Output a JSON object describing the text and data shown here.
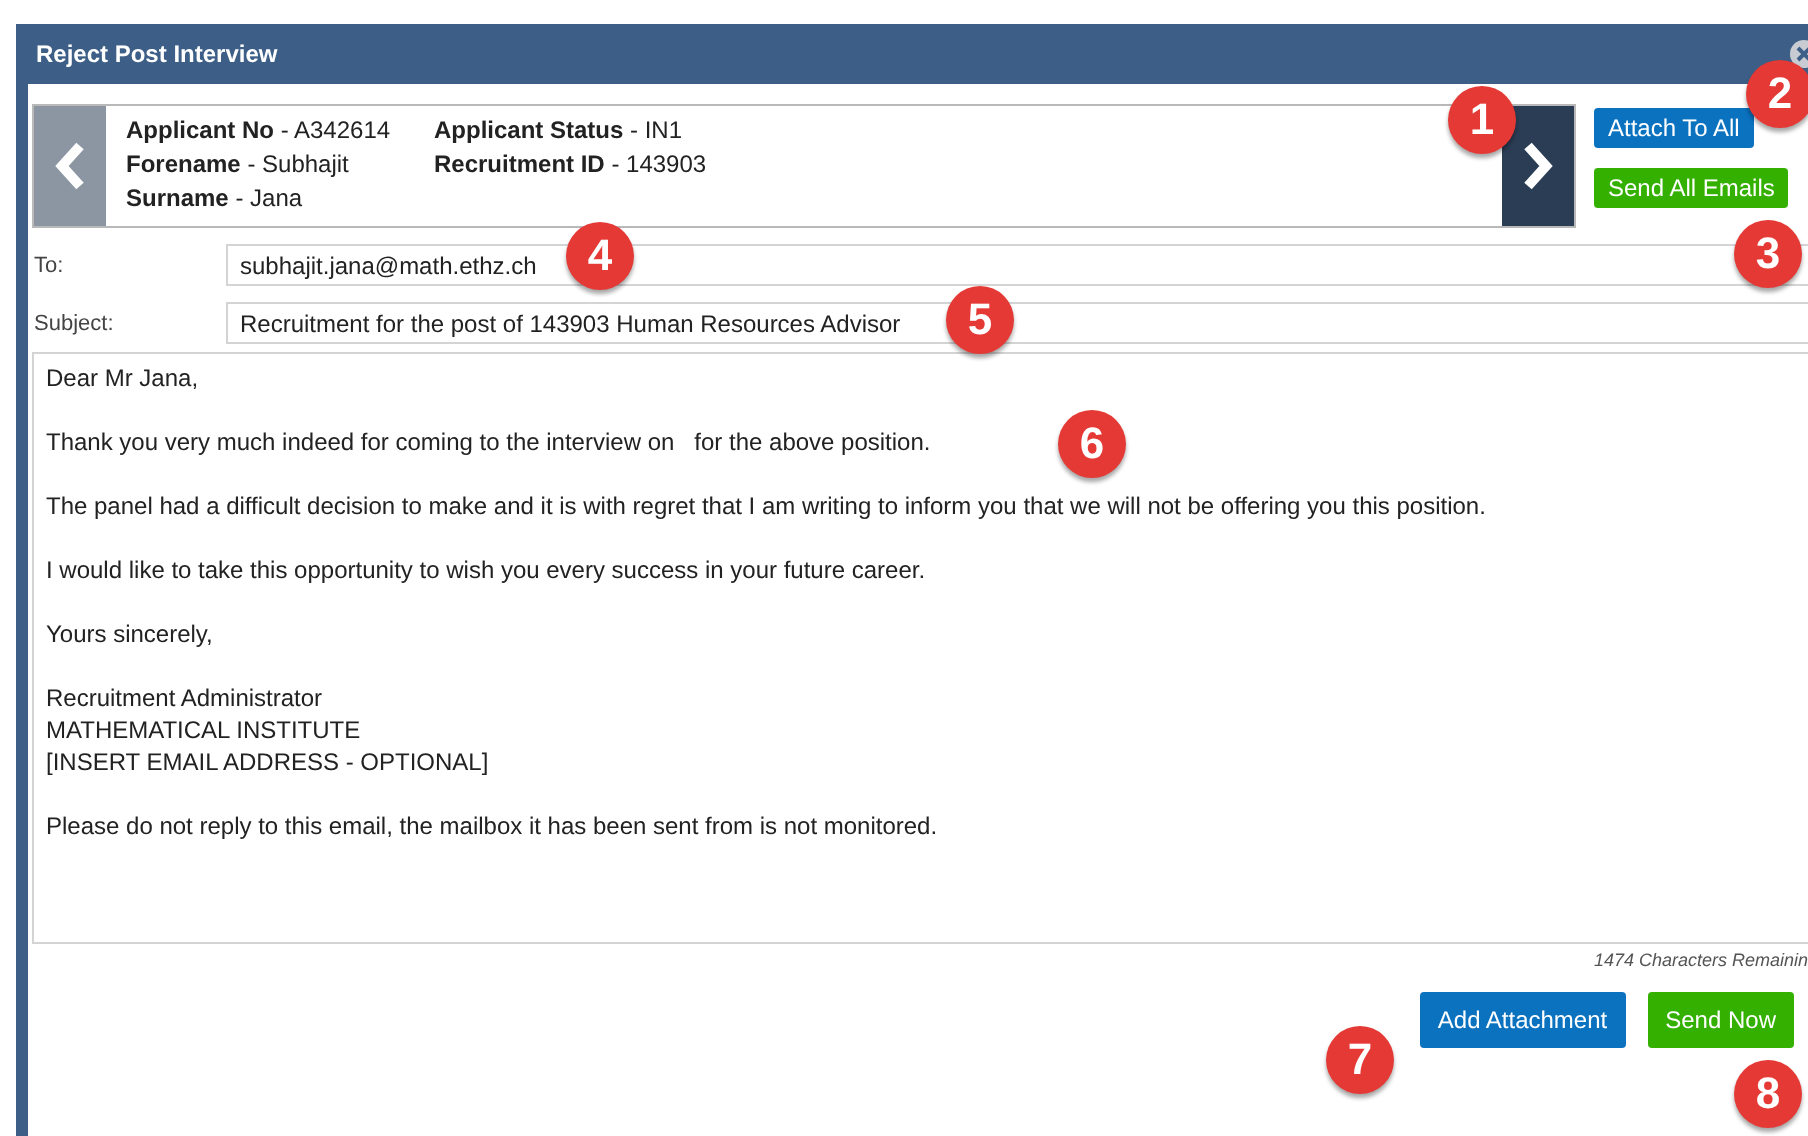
{
  "window": {
    "title": "Reject Post Interview"
  },
  "applicant": {
    "columns": [
      [
        {
          "label": "Applicant No",
          "value": "- A342614"
        },
        {
          "label": "Forename",
          "value": "- Subhajit"
        },
        {
          "label": "Surname",
          "value": "- Jana"
        }
      ],
      [
        {
          "label": "Applicant Status",
          "value": "- IN1"
        },
        {
          "label": "Recruitment ID",
          "value": "- 143903"
        }
      ]
    ]
  },
  "header_buttons": [
    {
      "label": "Attach To All",
      "kind": "primary"
    },
    {
      "label": "Send All Emails",
      "kind": "success"
    }
  ],
  "to": {
    "label": "To:",
    "value": "subhajit.jana@math.ethz.ch"
  },
  "subject": {
    "label": "Subject:",
    "value": "Recruitment for the post of 143903 Human Resources Advisor"
  },
  "body": {
    "paragraphs": [
      [
        "Dear Mr Jana,"
      ],
      [
        "Thank you very much indeed for coming to the interview on   for the above position."
      ],
      [
        "The panel had a difficult decision to make and it is with regret that I am writing to inform you that we will not be offering you this position."
      ],
      [
        "I would like to take this opportunity to wish you every success in your future career."
      ],
      [
        "Yours sincerely,"
      ],
      [
        "Recruitment Administrator",
        "MATHEMATICAL INSTITUTE",
        "[INSERT EMAIL ADDRESS - OPTIONAL]"
      ],
      [
        "Please do not reply to this email, the mailbox it has been sent from is not monitored."
      ]
    ]
  },
  "characters_remaining": "1474 Characters Remainin",
  "footer_buttons": [
    {
      "label": "Add Attachment",
      "kind": "primary"
    },
    {
      "label": "Send Now",
      "kind": "success"
    }
  ],
  "callouts": [
    "1",
    "2",
    "3",
    "4",
    "5",
    "6",
    "7",
    "8"
  ]
}
